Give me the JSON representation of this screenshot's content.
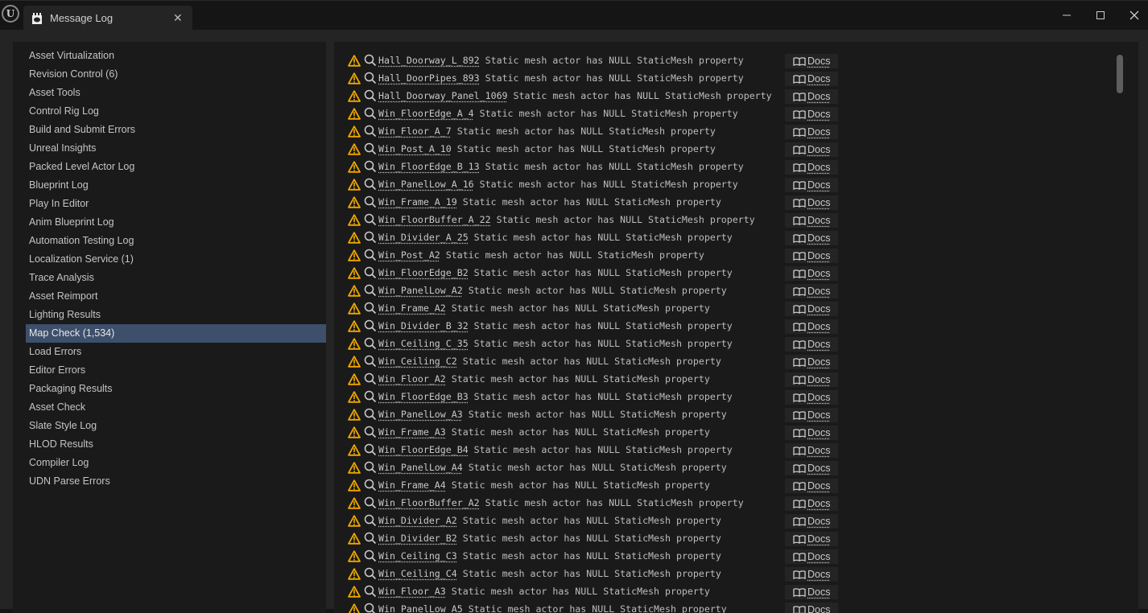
{
  "window": {
    "tab_title": "Message Log",
    "logo_text": "U"
  },
  "sidebar": {
    "selected": 15,
    "items": [
      "Asset Virtualization",
      "Revision Control (6)",
      "Asset Tools",
      "Control Rig Log",
      "Build and Submit Errors",
      "Unreal Insights",
      "Packed Level Actor Log",
      "Blueprint Log",
      "Play In Editor",
      "Anim Blueprint Log",
      "Automation Testing Log",
      "Localization Service (1)",
      "Trace Analysis",
      "Asset Reimport",
      "Lighting Results",
      "Map Check (1,534)",
      "Load Errors",
      "Editor Errors",
      "Packaging Results",
      "Asset Check",
      "Slate Style Log",
      "HLOD Results",
      "Compiler Log",
      "UDN Parse Errors"
    ]
  },
  "log": {
    "message": "Static mesh actor has NULL StaticMesh property",
    "docs_label": "Docs",
    "warning_color": "#f0a800",
    "rows": [
      "Hall_Doorway_L_892",
      "Hall_DoorPipes_893",
      "Hall_Doorway_Panel_1069",
      "Win_FloorEdge_A_4",
      "Win_Floor_A_7",
      "Win_Post_A_10",
      "Win_FloorEdge_B_13",
      "Win_PanelLow_A_16",
      "Win_Frame_A_19",
      "Win_FloorBuffer_A_22",
      "Win_Divider_A_25",
      "Win_Post_A2",
      "Win_FloorEdge_B2",
      "Win_PanelLow_A2",
      "Win_Frame_A2",
      "Win_Divider_B_32",
      "Win_Ceiling_C_35",
      "Win_Ceiling_C2",
      "Win_Floor_A2",
      "Win_FloorEdge_B3",
      "Win_PanelLow_A3",
      "Win_Frame_A3",
      "Win_FloorEdge_B4",
      "Win_PanelLow_A4",
      "Win_Frame_A4",
      "Win_FloorBuffer_A2",
      "Win_Divider_A2",
      "Win_Divider_B2",
      "Win_Ceiling_C3",
      "Win_Ceiling_C4",
      "Win_Floor_A3",
      "Win_PanelLow_A5"
    ]
  }
}
